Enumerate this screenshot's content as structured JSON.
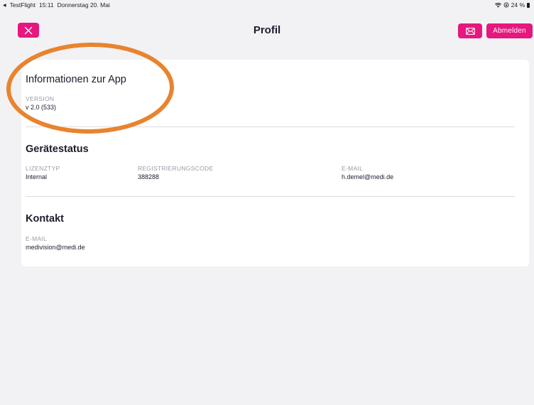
{
  "status_bar": {
    "back_app": "TestFlight",
    "time": "15:11",
    "date": "Donnerstag 20. Mai",
    "battery": "24 %"
  },
  "header": {
    "title": "Profil",
    "logout_label": "Abmelden",
    "close_icon": "close-icon",
    "mail_icon": "mail-icon"
  },
  "sections": {
    "app_info": {
      "title": "Informationen zur App",
      "version_label": "VERSION",
      "version_value": "v 2.0 (533)"
    },
    "device_status": {
      "title": "Gerätestatus",
      "license_label": "LIZENZTYP",
      "license_value": "Internal",
      "reg_label": "REGISTRIERUNGSCODE",
      "reg_value": "388288",
      "email_label": "E-MAIL",
      "email_value": "h.demel@medi.de"
    },
    "contact": {
      "title": "Kontakt",
      "email_label": "E-MAIL",
      "email_value": "medivision@medi.de"
    }
  },
  "colors": {
    "accent": "#e6177e",
    "annotation": "#e8842e",
    "background": "#f2f2f4"
  }
}
